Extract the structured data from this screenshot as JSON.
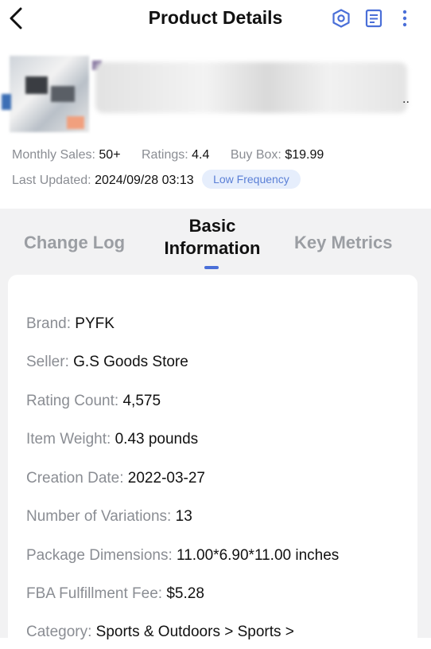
{
  "header": {
    "title": "Product Details",
    "icons": [
      "back-arrow-icon",
      "settings-icon",
      "notes-icon",
      "more-vertical-icon"
    ]
  },
  "product": {
    "ellipsis": "..",
    "monthly_sales_label": "Monthly Sales:",
    "monthly_sales_value": "50+",
    "ratings_label": "Ratings:",
    "ratings_value": "4.4",
    "buy_box_label": "Buy Box:",
    "buy_box_value": "$19.99",
    "last_updated_label": "Last Updated:",
    "last_updated_value": "2024/09/28 03:13",
    "frequency_badge": "Low Frequency"
  },
  "tabs": [
    {
      "label": "Change Log",
      "active": false
    },
    {
      "label": "Basic Information",
      "line1": "Basic",
      "line2": "Information",
      "active": true
    },
    {
      "label": "Key Metrics",
      "active": false
    }
  ],
  "details": [
    {
      "label": "Brand:",
      "value": "PYFK"
    },
    {
      "label": "Seller:",
      "value": "G.S Goods Store"
    },
    {
      "label": "Rating Count:",
      "value": "4,575"
    },
    {
      "label": "Item Weight:",
      "value": "0.43 pounds"
    },
    {
      "label": "Creation Date:",
      "value": "2022-03-27"
    },
    {
      "label": "Number of Variations:",
      "value": "13"
    },
    {
      "label": "Package Dimensions:",
      "value": "11.00*6.90*11.00 inches"
    },
    {
      "label": "FBA Fulfillment Fee:",
      "value": "$5.28"
    },
    {
      "label": "Category:",
      "value": "Sports & Outdoors > Sports >"
    }
  ],
  "colors": {
    "accent": "#4a6fd8",
    "badge_bg": "#e6eefc",
    "badge_text": "#5a7fd6",
    "label_gray": "#8a8d93",
    "tabs_bg": "#f2f2f3"
  }
}
